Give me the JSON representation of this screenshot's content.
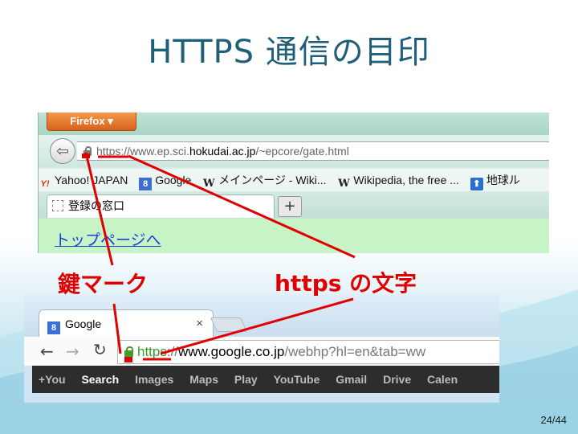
{
  "slide": {
    "title": "HTTPS 通信の目印",
    "page_number": "24/44"
  },
  "annotations": {
    "lock_label": "鍵マーク",
    "https_label": "https の文字",
    "color": "#e00000"
  },
  "firefox": {
    "menu_button": "Firefox ▾",
    "back_icon": "back-arrow-icon",
    "url": {
      "prefix": "https://www.ep.sci.",
      "host": "hokudai.ac.jp",
      "path": "/~epcore/gate.html"
    },
    "bookmarks": [
      {
        "icon": "Y!",
        "label": "Yahoo! JAPAN"
      },
      {
        "icon": "8",
        "label": "Google"
      },
      {
        "icon": "W",
        "label": "メインページ - Wiki..."
      },
      {
        "icon": "W",
        "label": "Wikipedia, the free ..."
      },
      {
        "icon": "⬆",
        "label": "地球ル"
      }
    ],
    "tab_label": "登録の窓口",
    "new_tab": "+",
    "content_link": "トップページへ"
  },
  "chrome": {
    "tab_label": "Google",
    "tab_close": "×",
    "url": {
      "scheme": "https",
      "sep": "://",
      "host": "www.google.co.jp",
      "path": "/webhp?hl=en&tab=ww"
    },
    "google_bar": [
      "+You",
      "Search",
      "Images",
      "Maps",
      "Play",
      "YouTube",
      "Gmail",
      "Drive",
      "Calen"
    ],
    "active_item": "Search"
  }
}
